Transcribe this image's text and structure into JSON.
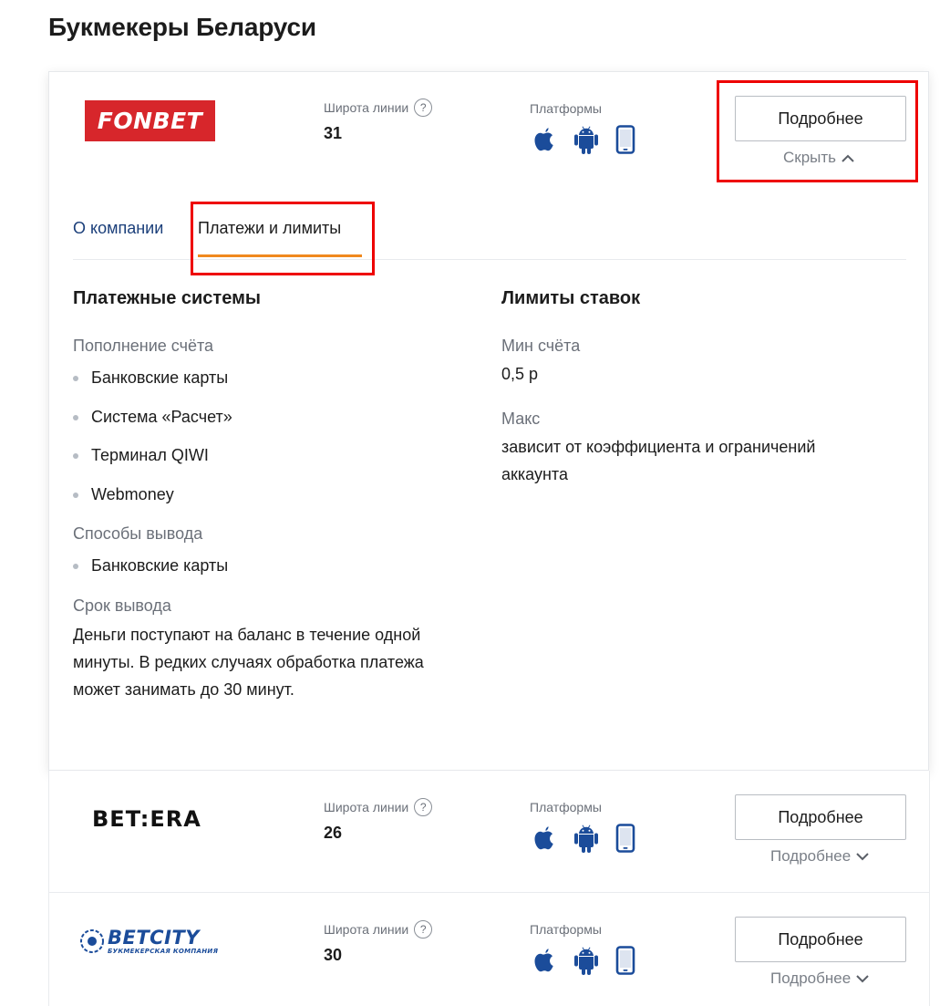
{
  "page": {
    "title": "Букмекеры Беларуси"
  },
  "colors": {
    "accent_orange": "#f0891e",
    "link_blue": "#1b3f7a",
    "platform_icon_blue": "#1b4c9a",
    "highlight_red": "#ee0000",
    "fonbet_red": "#d7262b"
  },
  "bookmakers": [
    {
      "name": "FONBET",
      "line_width_label": "Широта линии",
      "line_width_value": "31",
      "platforms_label": "Платформы",
      "platform_icons": [
        "apple-icon",
        "android-icon",
        "mobile-icon"
      ],
      "details_button": "Подробнее",
      "toggle_label": "Скрыть",
      "expanded": true,
      "tabs": [
        {
          "label": "О компании",
          "active": false
        },
        {
          "label": "Платежи и лимиты",
          "active": true
        }
      ],
      "payments": {
        "title": "Платежные системы",
        "deposit_label": "Пополнение счёта",
        "deposit_methods": [
          "Банковские карты",
          "Система «Расчет»",
          "Терминал QIWI",
          "Webmoney"
        ],
        "withdraw_label": "Способы вывода",
        "withdraw_methods": [
          "Банковские карты"
        ],
        "withdraw_time_label": "Срок вывода",
        "withdraw_time_lines": [
          "Деньги поступают на баланс в течение одной",
          "минуты. В редких случаях обработка платежа",
          "может занимать до 30 минут."
        ]
      },
      "limits": {
        "title": "Лимиты ставок",
        "min_label": "Мин счёта",
        "min_value": "0,5 р",
        "max_label": "Макс",
        "max_value_lines": [
          "зависит от коэффициента и ограничений",
          "аккаунта"
        ]
      }
    },
    {
      "name": "BET:ERA",
      "line_width_label": "Широта линии",
      "line_width_value": "26",
      "platforms_label": "Платформы",
      "platform_icons": [
        "apple-icon",
        "android-icon",
        "mobile-icon"
      ],
      "details_button": "Подробнее",
      "toggle_label": "Подробнее",
      "expanded": false
    },
    {
      "name": "BETCITY",
      "tagline": "БУКМЕКЕРСКАЯ КОМПАНИЯ",
      "line_width_label": "Широта линии",
      "line_width_value": "30",
      "platforms_label": "Платформы",
      "platform_icons": [
        "apple-icon",
        "android-icon",
        "mobile-icon"
      ],
      "details_button": "Подробнее",
      "toggle_label": "Подробнее",
      "expanded": false
    }
  ]
}
